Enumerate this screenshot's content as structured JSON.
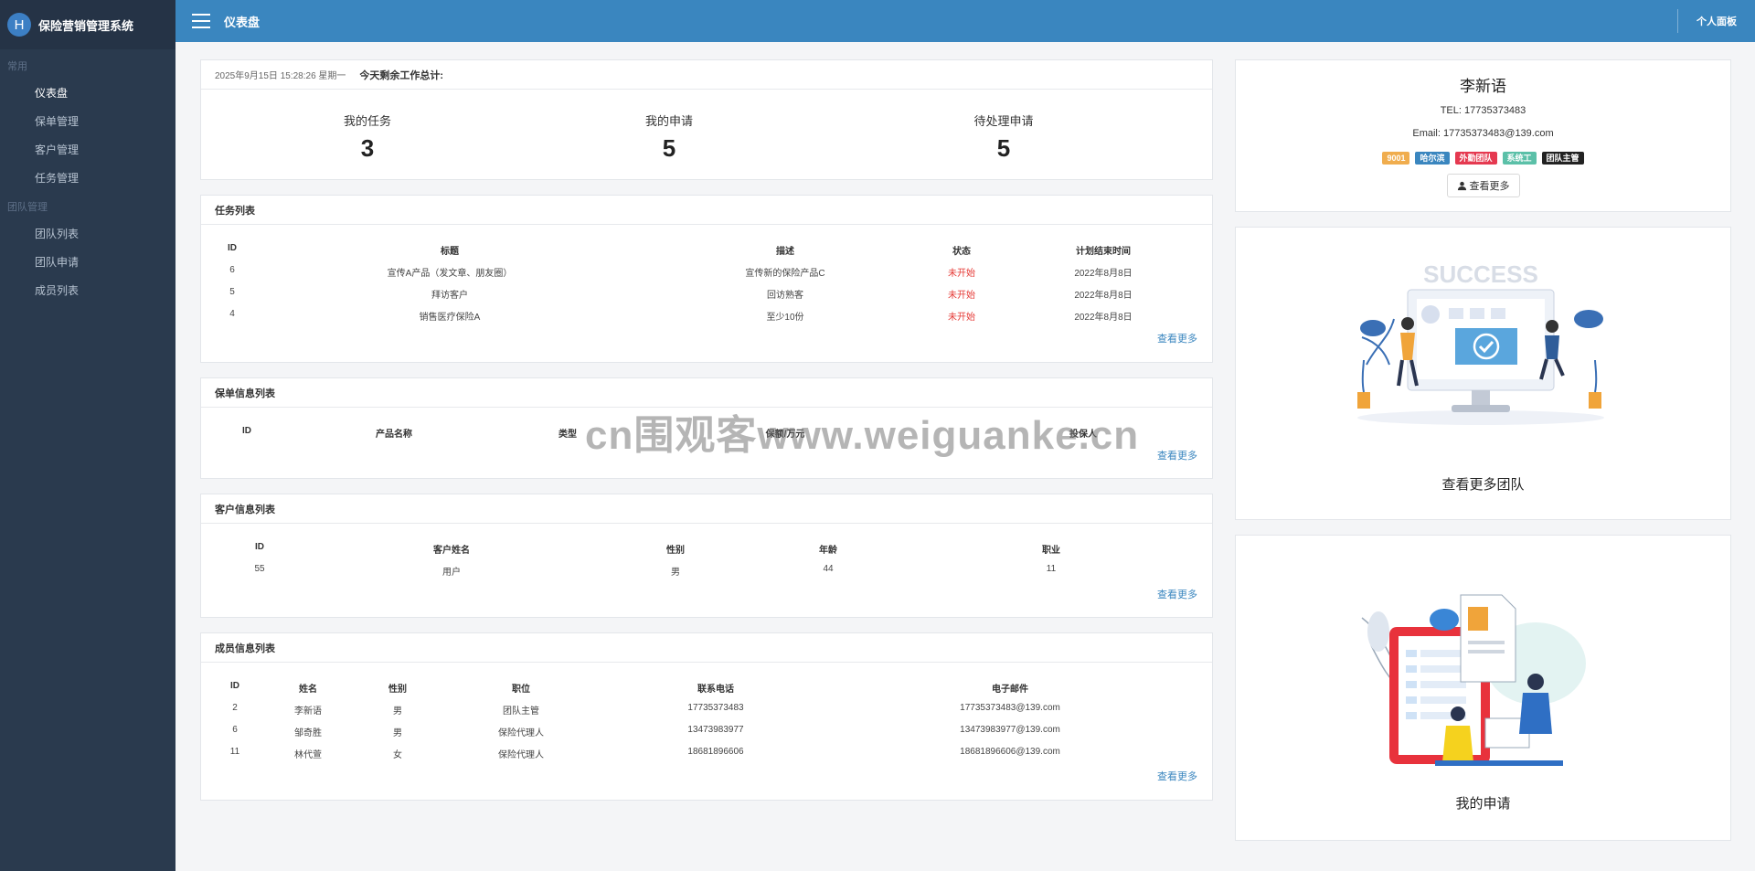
{
  "app": {
    "logo_letter": "H",
    "title": "保险营销管理系统"
  },
  "sidebar": {
    "sections": [
      {
        "label": "常用",
        "items": [
          "仪表盘",
          "保单管理",
          "客户管理",
          "任务管理"
        ]
      },
      {
        "label": "团队管理",
        "items": [
          "团队列表",
          "团队申请",
          "成员列表"
        ]
      }
    ]
  },
  "topbar": {
    "title": "仪表盘",
    "right_label": "个人面板"
  },
  "stats": {
    "datetime": "2025年9月15日 15:28:26 星期一",
    "summary": "今天剩余工作总计:",
    "items": [
      {
        "label": "我的任务",
        "value": "3"
      },
      {
        "label": "我的申请",
        "value": "5"
      },
      {
        "label": "待处理申请",
        "value": "5"
      }
    ]
  },
  "more_label": "查看更多",
  "tasks": {
    "title": "任务列表",
    "columns": [
      "ID",
      "标题",
      "描述",
      "状态",
      "计划结束时间"
    ],
    "rows": [
      [
        "6",
        "宣传A产品（发文章、朋友圈）",
        "宣传新的保险产品C",
        "未开始",
        "2022年8月8日"
      ],
      [
        "5",
        "拜访客户",
        "回访熟客",
        "未开始",
        "2022年8月8日"
      ],
      [
        "4",
        "销售医疗保险A",
        "至少10份",
        "未开始",
        "2022年8月8日"
      ]
    ]
  },
  "policies": {
    "title": "保单信息列表",
    "columns": [
      "ID",
      "产品名称",
      "类型",
      "保额/万元",
      "投保人"
    ],
    "rows": []
  },
  "customers": {
    "title": "客户信息列表",
    "columns": [
      "ID",
      "客户姓名",
      "性别",
      "年龄",
      "职业"
    ],
    "rows": [
      [
        "55",
        "用户",
        "男",
        "44",
        "11"
      ]
    ]
  },
  "members": {
    "title": "成员信息列表",
    "columns": [
      "ID",
      "姓名",
      "性别",
      "职位",
      "联系电话",
      "电子邮件"
    ],
    "rows": [
      [
        "2",
        "李新语",
        "男",
        "团队主管",
        "17735373483",
        "17735373483@139.com"
      ],
      [
        "6",
        "邹奇胜",
        "男",
        "保险代理人",
        "13473983977",
        "13473983977@139.com"
      ],
      [
        "11",
        "林代萱",
        "女",
        "保险代理人",
        "18681896606",
        "18681896606@139.com"
      ]
    ]
  },
  "profile": {
    "name": "李新语",
    "tel": "TEL: 17735373483",
    "email": "Email: 17735373483@139.com",
    "badges": [
      {
        "text": "9001",
        "color": "#f0ad4e"
      },
      {
        "text": "哈尔滨",
        "color": "#3a86bf"
      },
      {
        "text": "外勤团队",
        "color": "#e53950"
      },
      {
        "text": "系统工",
        "color": "#5bc0a8"
      },
      {
        "text": "团队主管",
        "color": "#222222"
      }
    ],
    "button_label": "查看更多"
  },
  "team_card": {
    "illus_text": "SUCCESS",
    "caption": "查看更多团队"
  },
  "apply_card": {
    "caption": "我的申请"
  },
  "watermark": "cn围观客www.weiguanke.cn"
}
